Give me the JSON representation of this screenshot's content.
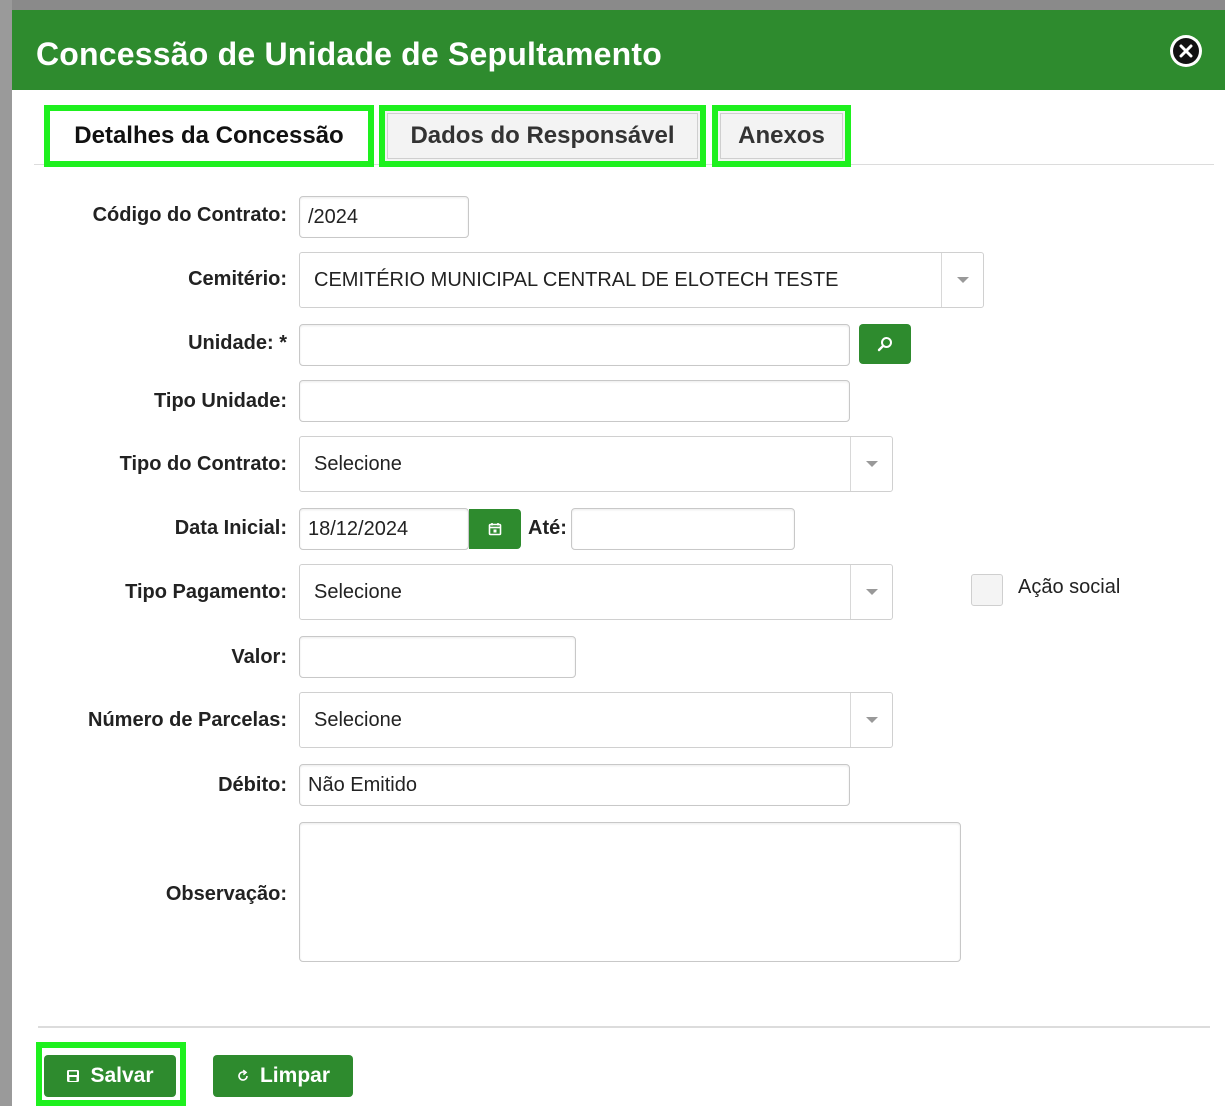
{
  "dialog": {
    "title": "Concessão de Unidade de Sepultamento"
  },
  "tabs": [
    {
      "label": "Detalhes da Concessão",
      "active": true
    },
    {
      "label": "Dados do Responsável",
      "active": false
    },
    {
      "label": "Anexos",
      "active": false
    }
  ],
  "form": {
    "codigo": {
      "label": "Código do Contrato:",
      "value": "/2024"
    },
    "cemiterio": {
      "label": "Cemitério:",
      "value": "CEMITÉRIO MUNICIPAL CENTRAL DE ELOTECH TESTE"
    },
    "unidade": {
      "label": "Unidade: *",
      "value": ""
    },
    "tipo_unidade": {
      "label": "Tipo Unidade:",
      "value": ""
    },
    "tipo_contrato": {
      "label": "Tipo do Contrato:",
      "value": "Selecione"
    },
    "data_inicial": {
      "label": "Data Inicial:",
      "value": "18/12/2024",
      "ate_label": "Até:",
      "ate_value": ""
    },
    "tipo_pagamento": {
      "label": "Tipo Pagamento:",
      "value": "Selecione"
    },
    "acao_social": {
      "label": "Ação social",
      "checked": false
    },
    "valor": {
      "label": "Valor:",
      "value": ""
    },
    "parcelas": {
      "label": "Número de Parcelas:",
      "value": "Selecione"
    },
    "debito": {
      "label": "Débito:",
      "value": "Não Emitido"
    },
    "observacao": {
      "label": "Observação:",
      "value": ""
    }
  },
  "buttons": {
    "save": "Salvar",
    "clear": "Limpar"
  },
  "colors": {
    "primary_green": "#2e8b2e",
    "highlight": "#1ef01e"
  },
  "icons": {
    "close": "close-circle-icon",
    "search": "search-icon",
    "calendar": "calendar-icon",
    "save": "floppy-disk-icon",
    "clear": "refresh-icon"
  }
}
